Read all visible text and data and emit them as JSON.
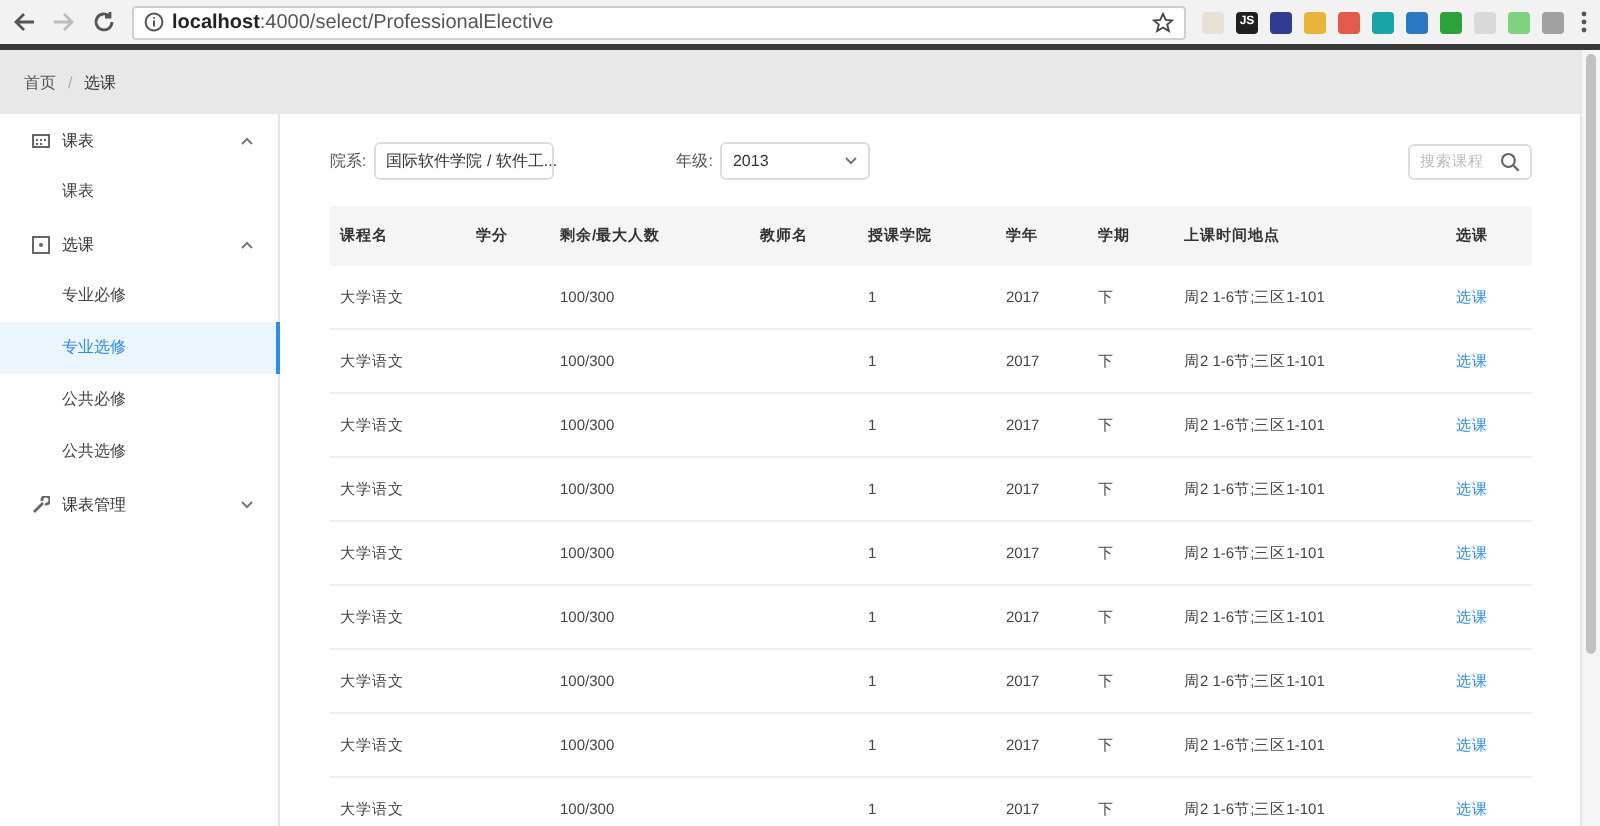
{
  "browser": {
    "url_host": "localhost",
    "url_path": ":4000/select/ProfessionalElective",
    "extensions": [
      {
        "color": "#e9e1d6"
      },
      {
        "label": "JS",
        "color": "#1f1f1f"
      },
      {
        "color": "#2f3b8f"
      },
      {
        "color": "#e8b43a"
      },
      {
        "color": "#e45a4a"
      },
      {
        "color": "#18a5a8"
      },
      {
        "color": "#2b78c4"
      },
      {
        "color": "#2aa33a"
      },
      {
        "color": "#d9d9d9"
      },
      {
        "color": "#7fd37f"
      },
      {
        "color": "#a0a0a0"
      }
    ]
  },
  "breadcrumb": {
    "items": [
      "首页",
      "选课"
    ],
    "separator": "/"
  },
  "sidebar": [
    {
      "label": "课表",
      "expanded": true,
      "children": [
        {
          "label": "课表",
          "selected": false
        }
      ]
    },
    {
      "label": "选课",
      "expanded": true,
      "children": [
        {
          "label": "专业必修",
          "selected": false
        },
        {
          "label": "专业选修",
          "selected": true
        },
        {
          "label": "公共必修",
          "selected": false
        },
        {
          "label": "公共选修",
          "selected": false
        }
      ]
    },
    {
      "label": "课表管理",
      "expanded": false
    }
  ],
  "filters": {
    "department_label": "院系:",
    "department_value": "国际软件学院 / 软件工...",
    "grade_label": "年级:",
    "grade_value": "2013",
    "search": {
      "placeholder": "搜索课程"
    }
  },
  "table": {
    "columns": [
      "课程名",
      "学分",
      "剩余/最大人数",
      "教师名",
      "授课学院",
      "学年",
      "学期",
      "上课时间地点",
      "选课"
    ],
    "rows": [
      {
        "course": "大学语文",
        "remaining": "100/300",
        "college": "1",
        "year": "2017",
        "term": "下",
        "time_place": "周2 1-6节;三区1-101",
        "action": "选课"
      },
      {
        "course": "大学语文",
        "remaining": "100/300",
        "college": "1",
        "year": "2017",
        "term": "下",
        "time_place": "周2 1-6节;三区1-101",
        "action": "选课"
      },
      {
        "course": "大学语文",
        "remaining": "100/300",
        "college": "1",
        "year": "2017",
        "term": "下",
        "time_place": "周2 1-6节;三区1-101",
        "action": "选课"
      },
      {
        "course": "大学语文",
        "remaining": "100/300",
        "college": "1",
        "year": "2017",
        "term": "下",
        "time_place": "周2 1-6节;三区1-101",
        "action": "选课"
      },
      {
        "course": "大学语文",
        "remaining": "100/300",
        "college": "1",
        "year": "2017",
        "term": "下",
        "time_place": "周2 1-6节;三区1-101",
        "action": "选课"
      },
      {
        "course": "大学语文",
        "remaining": "100/300",
        "college": "1",
        "year": "2017",
        "term": "下",
        "time_place": "周2 1-6节;三区1-101",
        "action": "选课"
      },
      {
        "course": "大学语文",
        "remaining": "100/300",
        "college": "1",
        "year": "2017",
        "term": "下",
        "time_place": "周2 1-6节;三区1-101",
        "action": "选课"
      },
      {
        "course": "大学语文",
        "remaining": "100/300",
        "college": "1",
        "year": "2017",
        "term": "下",
        "time_place": "周2 1-6节;三区1-101",
        "action": "选课"
      },
      {
        "course": "大学语文",
        "remaining": "100/300",
        "college": "1",
        "year": "2017",
        "term": "下",
        "time_place": "周2 1-6节;三区1-101",
        "action": "选课"
      }
    ]
  }
}
